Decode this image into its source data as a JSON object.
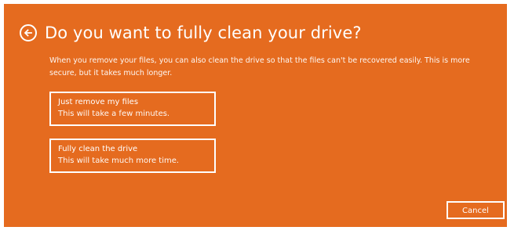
{
  "dialog": {
    "title": "Do you want to fully clean your drive?",
    "description": "When you remove your files, you can also clean the drive so that the files can't be recovered easily. This is more secure, but it takes much longer.",
    "options": [
      {
        "title": "Just remove my files",
        "subtitle": "This will take a few minutes."
      },
      {
        "title": "Fully clean the drive",
        "subtitle": "This will take much more time."
      }
    ],
    "cancel_label": "Cancel"
  },
  "colors": {
    "background": "#e56b1f",
    "text": "#ffffff",
    "page": "#ffffff"
  },
  "icons": {
    "back": "back-arrow-icon"
  }
}
